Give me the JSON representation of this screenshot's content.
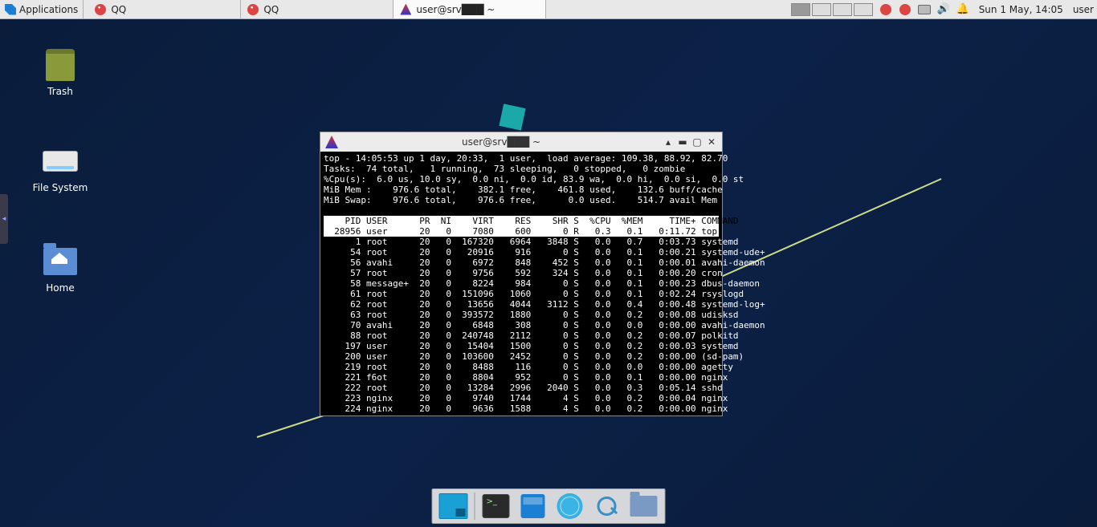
{
  "panel": {
    "apps_label": "Applications",
    "tasks": [
      {
        "label": "QQ",
        "icon": "qq"
      },
      {
        "label": "QQ",
        "icon": "qq"
      },
      {
        "label": "user@srv███ ~",
        "icon": "term",
        "active": true
      }
    ],
    "clock": "Sun  1 May, 14:05",
    "user": "user"
  },
  "desktop_icons": {
    "trash": "Trash",
    "filesystem": "File System",
    "home": "Home"
  },
  "terminal": {
    "title": "user@srv███ ~",
    "summary": {
      "line1": "top - 14:05:53 up 1 day, 20:33,  1 user,  load average: 109.38, 88.92, 82.70",
      "line2": "Tasks:  74 total,   1 running,  73 sleeping,   0 stopped,   0 zombie",
      "line3": "%Cpu(s):  6.0 us, 10.0 sy,  0.0 ni,  0.0 id, 83.9 wa,  0.0 hi,  0.0 si,  0.0 st",
      "line4": "MiB Mem :    976.6 total,    382.1 free,    461.8 used,    132.6 buff/cache",
      "line5": "MiB Swap:    976.6 total,    976.6 free,      0.0 used.    514.7 avail Mem"
    },
    "header": "    PID USER      PR  NI    VIRT    RES    SHR S  %CPU  %MEM     TIME+ COMMAND     ",
    "rows": [
      "  28956 user      20   0    7080    600      0 R   0.3   0.1   0:11.72 top         ",
      "      1 root      20   0  167320   6964   3848 S   0.0   0.7   0:03.73 systemd     ",
      "     54 root      20   0   20916    916      0 S   0.0   0.1   0:00.21 systemd-ude+",
      "     56 avahi     20   0    6972    848    452 S   0.0   0.1   0:00.01 avahi-daemon",
      "     57 root      20   0    9756    592    324 S   0.0   0.1   0:00.20 cron        ",
      "     58 message+  20   0    8224    984      0 S   0.0   0.1   0:00.23 dbus-daemon ",
      "     61 root      20   0  151096   1060      0 S   0.0   0.1   0:02.24 rsyslogd    ",
      "     62 root      20   0   13656   4044   3112 S   0.0   0.4   0:00.48 systemd-log+",
      "     63 root      20   0  393572   1880      0 S   0.0   0.2   0:00.08 udisksd     ",
      "     70 avahi     20   0    6848    308      0 S   0.0   0.0   0:00.00 avahi-daemon",
      "     88 root      20   0  240748   2112      0 S   0.0   0.2   0:00.07 polkitd     ",
      "    197 user      20   0   15404   1500      0 S   0.0   0.2   0:00.03 systemd     ",
      "    200 user      20   0  103600   2452      0 S   0.0   0.2   0:00.00 (sd-pam)    ",
      "    219 root      20   0    8488    116      0 S   0.0   0.0   0:00.00 agetty      ",
      "    221 f6ot      20   0    8804    952      0 S   0.0   0.1   0:00.00 nginx       ",
      "    222 root      20   0   13284   2996   2040 S   0.0   0.3   0:05.14 sshd        ",
      "    223 nginx     20   0    9740   1744      4 S   0.0   0.2   0:00.04 nginx       ",
      "    224 nginx     20   0    9636   1588      4 S   0.0   0.2   0:00.00 nginx       "
    ]
  }
}
